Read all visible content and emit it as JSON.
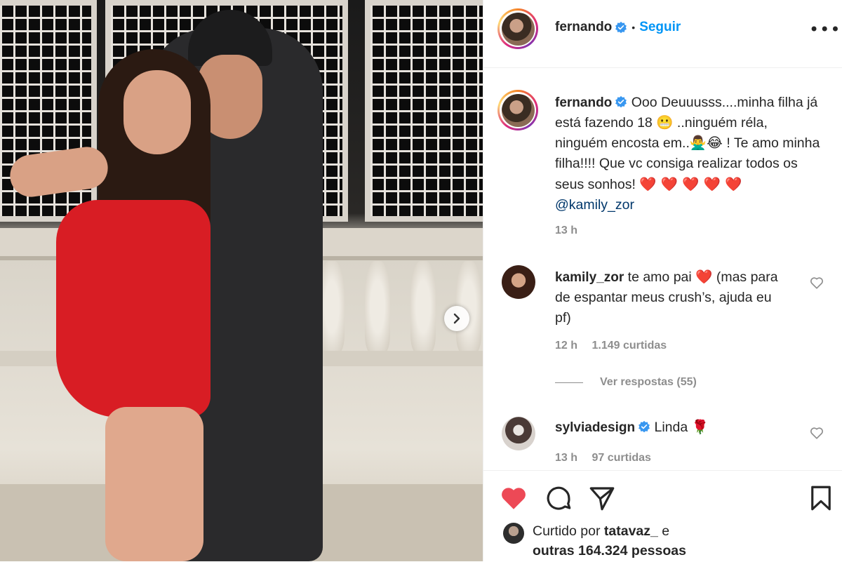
{
  "post": {
    "author": "fernando",
    "follow_label": "Seguir",
    "separator": "•",
    "more_label": "•••",
    "caption_part1": "Ooo Deuuusss....minha filha já está fazendo 18 ",
    "caption_emoji1": "😬",
    "caption_part2": " ..ninguém réla, ninguém encosta em..",
    "caption_emoji2": "🙅‍♂️😂",
    "caption_part3": " ! Te amo minha filha!!!! Que vc consiga realizar todos os seus sonhos! ",
    "caption_hearts": "❤️ ❤️ ❤️ ❤️ ❤️",
    "caption_mention": "@kamily_zor",
    "caption_time": "13 h"
  },
  "comments": [
    {
      "user": "kamily_zor",
      "text_before": "te amo pai ",
      "emoji": "❤️",
      "text_after": " (mas para de espantar meus crush’s, ajuda eu pf)",
      "time": "12 h",
      "likes": "1.149 curtidas",
      "replies": "Ver respostas (55)"
    },
    {
      "user": "sylviadesign",
      "text_before": "Linda ",
      "emoji": "🌹",
      "text_after": "",
      "time": "13 h",
      "likes": "97 curtidas"
    }
  ],
  "likes_summary": {
    "prefix": "Curtido por ",
    "user": "tatavaz_",
    "middle": " e",
    "others": "outras 164.324 pessoas"
  },
  "icons": {
    "verified": "verified-badge-icon",
    "heart_filled": "heart-filled-icon",
    "comment": "comment-bubble-icon",
    "share": "paper-plane-icon",
    "save": "bookmark-icon",
    "next": "chevron-right-icon",
    "like_small": "heart-outline-icon"
  },
  "colors": {
    "accent": "#0095f6",
    "like_red": "#ed4956",
    "mention": "#00376b",
    "muted": "#8e8e8e"
  }
}
